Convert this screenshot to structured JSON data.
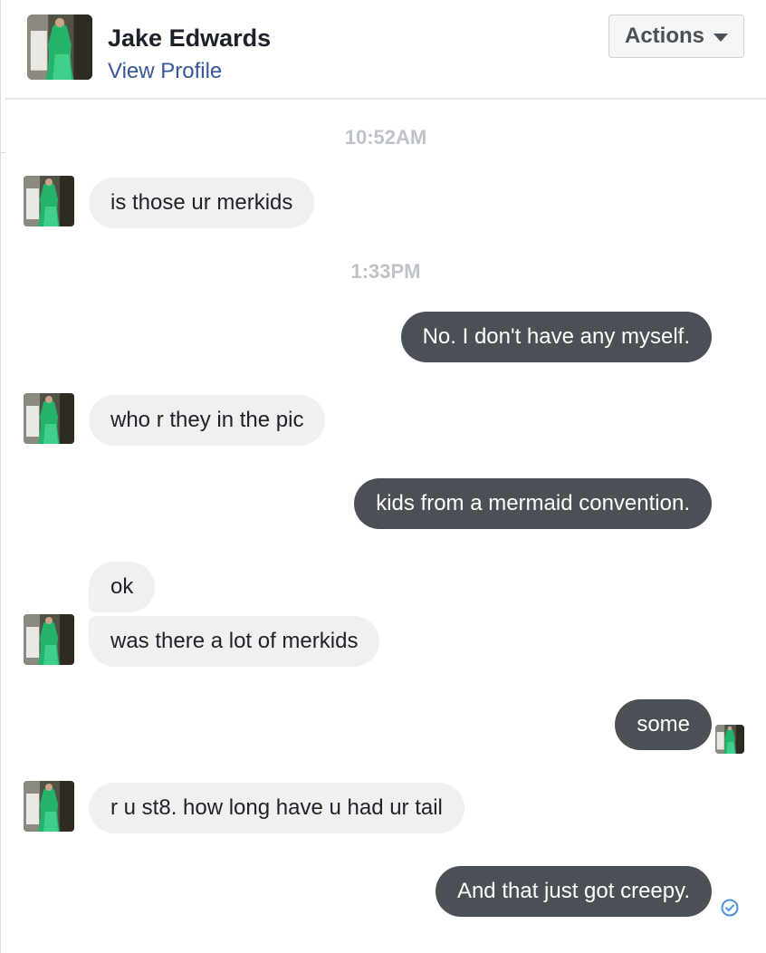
{
  "header": {
    "name": "Jake Edwards",
    "profile_link": "View Profile",
    "actions_label": "Actions",
    "avatar_icon": "profile-photo"
  },
  "messages": [
    {
      "type": "timestamp",
      "text": "10:52AM"
    },
    {
      "type": "incoming",
      "text": "is those ur merkids"
    },
    {
      "type": "timestamp",
      "text": "1:33PM"
    },
    {
      "type": "outgoing",
      "text": "No.  I don't have any myself."
    },
    {
      "type": "incoming",
      "text": "who r they in the pic"
    },
    {
      "type": "outgoing",
      "text": "kids from a mermaid convention."
    },
    {
      "type": "incoming",
      "text": "ok"
    },
    {
      "type": "incoming",
      "text": "was there a lot of merkids"
    },
    {
      "type": "outgoing",
      "text": "some",
      "status": "seen"
    },
    {
      "type": "incoming",
      "text": "r u st8. how long have u had ur tail"
    },
    {
      "type": "outgoing",
      "text": "And that just got creepy.",
      "status": "sent"
    }
  ],
  "colors": {
    "incoming_bubble": "#f1f0f0",
    "outgoing_bubble": "#4b4f56",
    "link": "#365899",
    "timestamp": "#bec2c9",
    "sent_check": "#4a90e2"
  }
}
